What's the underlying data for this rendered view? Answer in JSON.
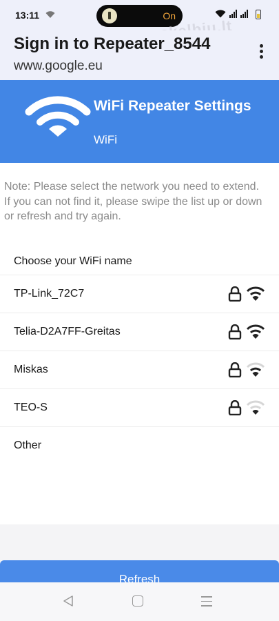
{
  "status_bar": {
    "time": "13:11",
    "indicator_text": "On",
    "watermark": "skelbiu.lt"
  },
  "browser": {
    "page_title": "Sign in to Repeater_8544",
    "url": "www.google.eu"
  },
  "banner": {
    "title": "WiFi Repeater Settings",
    "subtitle": "WiFi",
    "color": "#4286e5"
  },
  "note": "Note: Please select the network you need to extend. If you can not find it, please swipe the list up or down or refresh and try again.",
  "list_header": "Choose your WiFi name",
  "networks": [
    {
      "name": "TP-Link_72C7",
      "locked": true,
      "signal_bars": 3,
      "icons": [
        "lock-icon",
        "wifi-signal-icon"
      ]
    },
    {
      "name": "Telia-D2A7FF-Greitas",
      "locked": true,
      "signal_bars": 3,
      "icons": [
        "lock-icon",
        "wifi-signal-icon"
      ]
    },
    {
      "name": "Miskas",
      "locked": true,
      "signal_bars": 2,
      "icons": [
        "lock-icon",
        "wifi-signal-icon"
      ]
    },
    {
      "name": "TEO-S",
      "locked": true,
      "signal_bars": 1,
      "icons": [
        "lock-icon",
        "wifi-signal-icon"
      ]
    },
    {
      "name": "Other"
    }
  ],
  "refresh_label": "Refresh",
  "nav": {
    "icons": [
      "back-icon",
      "home-icon",
      "recents-icon"
    ]
  }
}
